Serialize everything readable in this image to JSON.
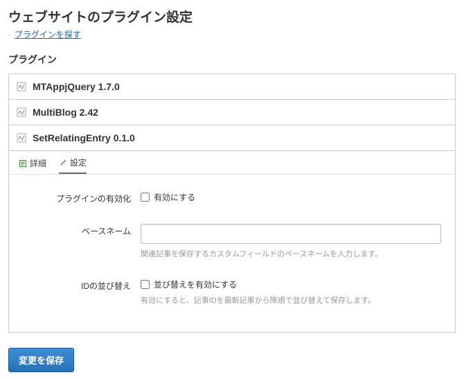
{
  "page_title": "ウェブサイトのプラグイン設定",
  "search_link": "プラグインを探す",
  "section_title": "プラグイン",
  "plugins": [
    {
      "name": "MTAppjQuery 1.7.0"
    },
    {
      "name": "MultiBlog 2.42"
    },
    {
      "name": "SetRelatingEntry 0.1.0"
    }
  ],
  "tabs": {
    "detail": "詳細",
    "settings": "設定"
  },
  "form": {
    "enable_label": "プラグインの有効化",
    "enable_checkbox": "有効にする",
    "basename_label": "ベースネーム",
    "basename_value": "",
    "basename_help": "関連記事を保存するカスタムフィールドのベースネームを入力します。",
    "reorder_label": "IDの並び替え",
    "reorder_checkbox": "並び替えを有効にする",
    "reorder_help": "有効にすると、記事IDを最新記事から降順で並び替えて保存します。"
  },
  "save_button": "変更を保存"
}
